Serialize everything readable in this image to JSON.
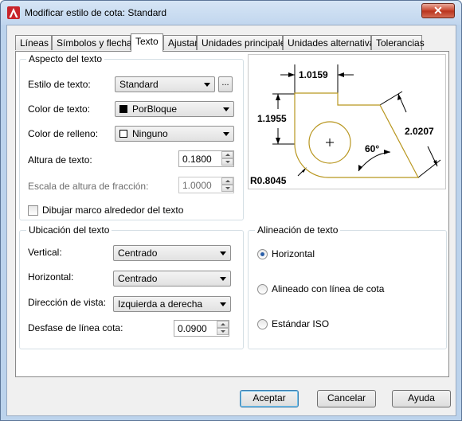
{
  "window": {
    "title": "Modificar estilo de cota: Standard",
    "close_glyph": "✕"
  },
  "tabs": [
    {
      "label": "Líneas"
    },
    {
      "label": "Símbolos y flechas"
    },
    {
      "label": "Texto"
    },
    {
      "label": "Ajustar"
    },
    {
      "label": "Unidades principales"
    },
    {
      "label": "Unidades alternativas"
    },
    {
      "label": "Tolerancias"
    }
  ],
  "active_tab": "Texto",
  "text_appearance": {
    "legend": "Aspecto del texto",
    "style_label": "Estilo de texto:",
    "style_value": "Standard",
    "style_browse": "...",
    "color_label": "Color de texto:",
    "color_value": "PorBloque",
    "color_swatch": "#000000",
    "fill_label": "Color de relleno:",
    "fill_value": "Ninguno",
    "fill_swatch": "#ffffff",
    "height_label": "Altura de texto:",
    "height_value": "0.1800",
    "fraction_label": "Escala de altura de fracción:",
    "fraction_value": "1.0000",
    "frame_label": "Dibujar marco alrededor del texto",
    "frame_checked": false
  },
  "preview": {
    "dim_top": "1.0159",
    "dim_left": "1.1955",
    "dim_right": "2.0207",
    "dim_angle": "60°",
    "dim_radius": "R0.8045",
    "part_color": "#b8961f"
  },
  "text_placement": {
    "legend": "Ubicación del texto",
    "vertical_label": "Vertical:",
    "vertical_value": "Centrado",
    "horizontal_label": "Horizontal:",
    "horizontal_value": "Centrado",
    "direction_label": "Dirección de vista:",
    "direction_value": "Izquierda a derecha",
    "offset_label": "Desfase de línea cota:",
    "offset_value": "0.0900"
  },
  "text_alignment": {
    "legend": "Alineación de texto",
    "options": [
      {
        "label": "Horizontal",
        "checked": true
      },
      {
        "label": "Alineado con línea de cota",
        "checked": false
      },
      {
        "label": "Estándar ISO",
        "checked": false
      }
    ]
  },
  "buttons": {
    "accept": "Aceptar",
    "cancel": "Cancelar",
    "help": "Ayuda"
  }
}
